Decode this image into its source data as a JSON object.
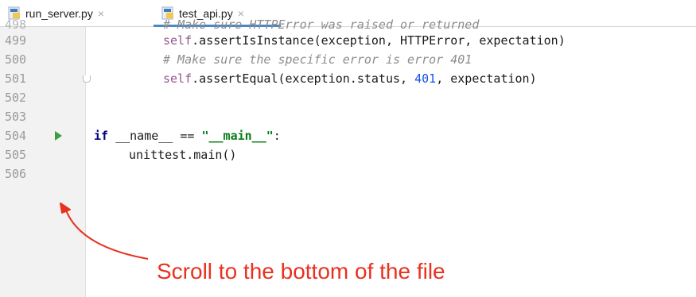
{
  "tabs": [
    {
      "label": "run_server.py",
      "active": false,
      "close": "×"
    },
    {
      "label": "test_api.py",
      "active": true,
      "close": "×"
    }
  ],
  "editor": {
    "partial_top_text": "# Make sure HTTPError was raised or returned",
    "lines": [
      {
        "num": "499"
      },
      {
        "num": "500"
      },
      {
        "num": "501"
      },
      {
        "num": "502"
      },
      {
        "num": "503"
      },
      {
        "num": "504"
      },
      {
        "num": "505"
      },
      {
        "num": "506"
      }
    ],
    "code": {
      "l499_self": "self",
      "l499_rest": ".assertIsInstance(exception, HTTPError, expectation)",
      "l500_comment": "# Make sure the specific error is error 401",
      "l501_self": "self",
      "l501_a": ".assertEqual(exception.status, ",
      "l501_num": "401",
      "l501_b": ", expectation)",
      "l504_kw": "if",
      "l504_a": " __name__ == ",
      "l504_str": "\"__main__\"",
      "l504_b": ":",
      "l505": "unittest.main()"
    },
    "run_icon": "run-gutter-icon",
    "fold_icon": "fold-icon"
  },
  "annotation": {
    "text": "Scroll to the bottom of the file",
    "color": "#e8321f"
  },
  "colors": {
    "keyword": "#000080",
    "self": "#94558d",
    "number": "#1750eb",
    "string": "#067d17",
    "comment": "#8c8c8c",
    "run": "#3c9e3c",
    "tab_accent": "#4a88c7"
  }
}
